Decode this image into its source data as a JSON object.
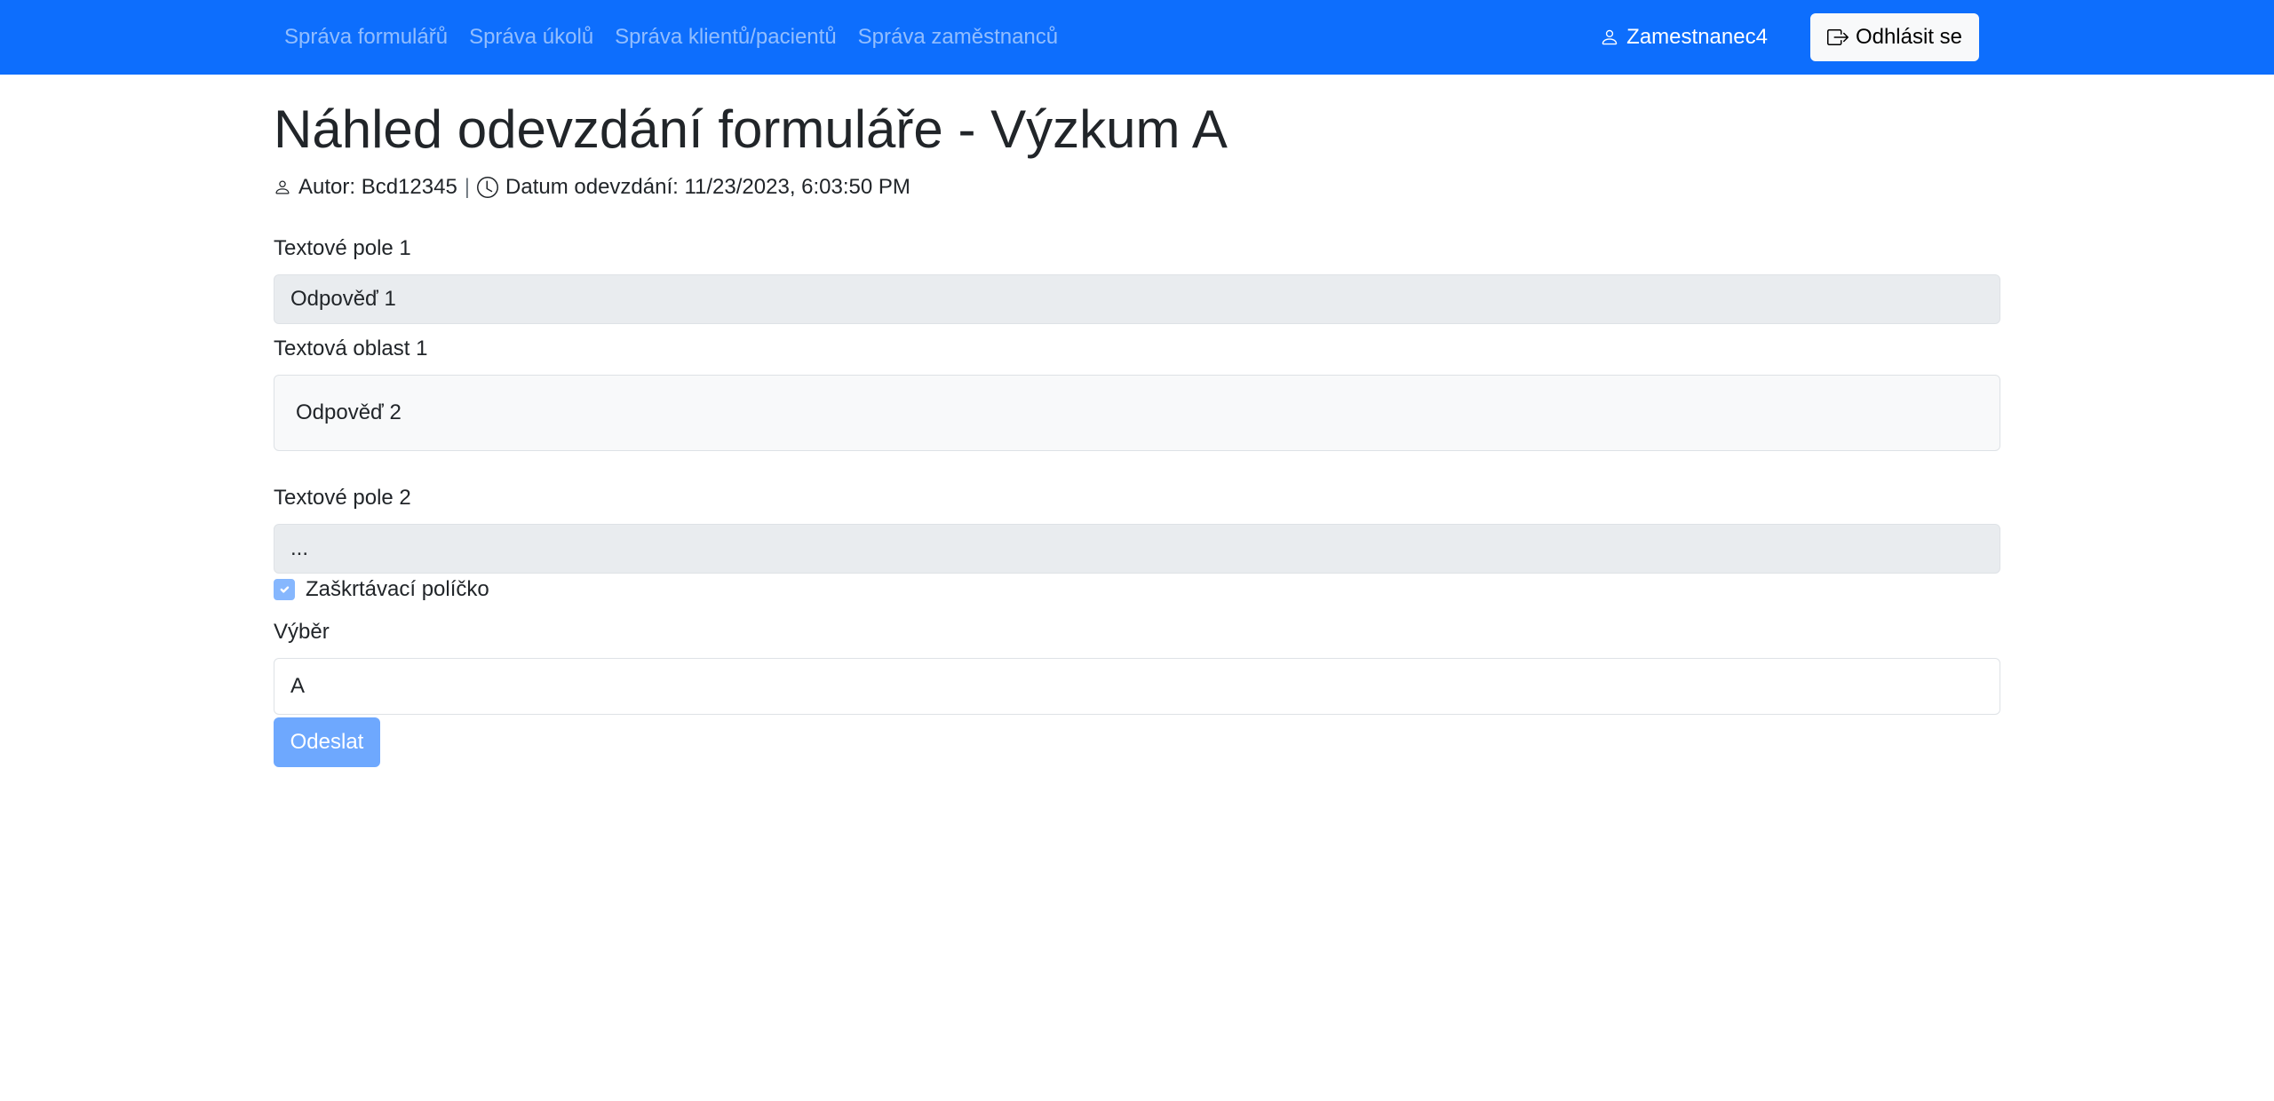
{
  "nav": {
    "links": [
      {
        "label": "Správa formulářů"
      },
      {
        "label": "Správa úkolů"
      },
      {
        "label": "Správa klientů/pacientů"
      },
      {
        "label": "Správa zaměstnanců"
      }
    ],
    "user": "Zamestnanec4",
    "logout_label": "Odhlásit se",
    "user_icon": "person-icon",
    "logout_icon": "box-arrow-right-icon",
    "accent_color": "#0d6efd"
  },
  "page": {
    "title": "Náhled odevzdání formuláře - Výzkum A",
    "meta": {
      "author": "Autor: Bcd12345",
      "separator": "|",
      "submitted": "Datum odevzdání: 11/23/2023, 6:03:50 PM",
      "author_icon": "person-icon",
      "time_icon": "clock-icon"
    }
  },
  "form": {
    "text_field_1": {
      "label": "Textové pole 1",
      "value": "Odpověď 1"
    },
    "text_area_1": {
      "label": "Textová oblast 1",
      "value": "Odpověď 2"
    },
    "text_field_2": {
      "label": "Textové pole 2",
      "value": "..."
    },
    "checkbox": {
      "label": "Zaškrtávací políčko",
      "checked": true
    },
    "select": {
      "label": "Výběr",
      "value": "A"
    },
    "submit_label": "Odeslat"
  }
}
